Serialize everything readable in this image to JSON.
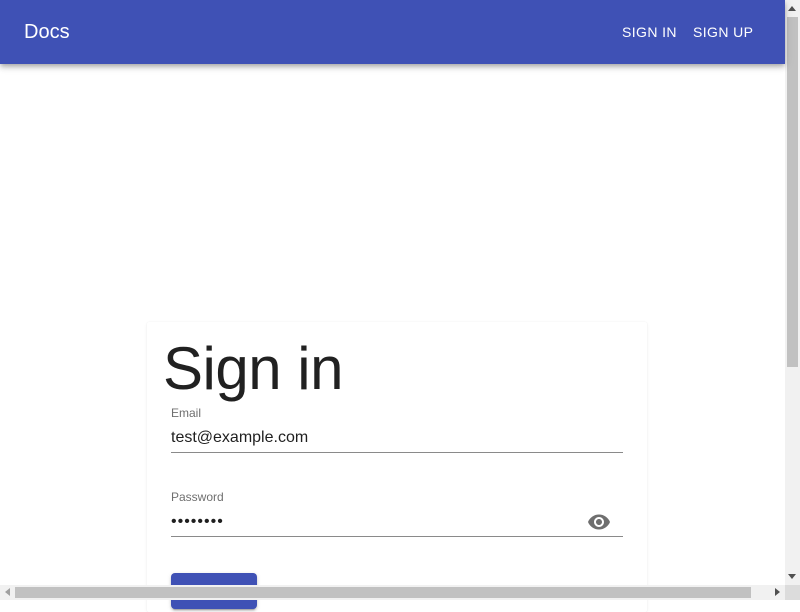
{
  "appbar": {
    "brand": "Docs",
    "nav": {
      "sign_in": "SIGN IN",
      "sign_up": "SIGN UP"
    },
    "color": "#3f51b5"
  },
  "signin_card": {
    "title": "Sign in",
    "email": {
      "label": "Email",
      "value": "test@example.com"
    },
    "password": {
      "label": "Password",
      "value": "••••••••",
      "toggle_icon": "eye-icon"
    },
    "submit_color": "#3f51b5"
  }
}
